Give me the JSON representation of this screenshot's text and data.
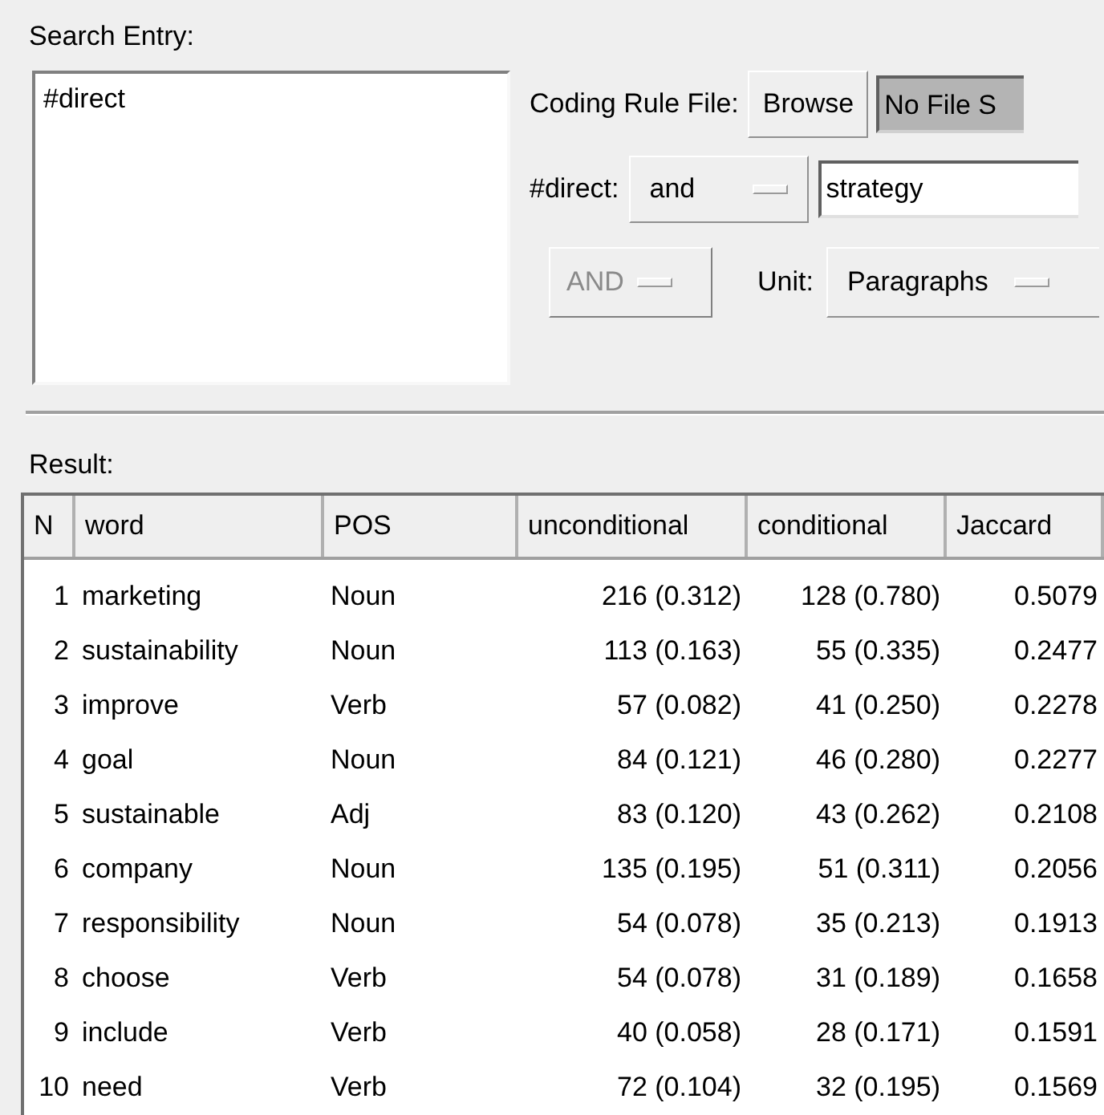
{
  "search_entry": {
    "label": "Search Entry:",
    "value": "#direct"
  },
  "coding_rule": {
    "label": "Coding Rule File:",
    "browse_button": "Browse",
    "file_field": "No File S"
  },
  "condition": {
    "label": "#direct:",
    "operator": "and",
    "value": "strategy"
  },
  "combine": {
    "operator": "AND",
    "disabled": true,
    "unit_label": "Unit:",
    "unit": "Paragraphs"
  },
  "result": {
    "label": "Result:",
    "columns": [
      "N",
      "word",
      "POS",
      "unconditional",
      "conditional",
      "Jaccard"
    ],
    "rows": [
      [
        "1",
        "marketing",
        "Noun",
        "216 (0.312)",
        "128 (0.780)",
        "0.5079"
      ],
      [
        "2",
        "sustainability",
        "Noun",
        "113 (0.163)",
        "55 (0.335)",
        "0.2477"
      ],
      [
        "3",
        "improve",
        "Verb",
        "57 (0.082)",
        "41 (0.250)",
        "0.2278"
      ],
      [
        "4",
        "goal",
        "Noun",
        "84 (0.121)",
        "46 (0.280)",
        "0.2277"
      ],
      [
        "5",
        "sustainable",
        "Adj",
        "83 (0.120)",
        "43 (0.262)",
        "0.2108"
      ],
      [
        "6",
        "company",
        "Noun",
        "135 (0.195)",
        "51 (0.311)",
        "0.2056"
      ],
      [
        "7",
        "responsibility",
        "Noun",
        "54 (0.078)",
        "35 (0.213)",
        "0.1913"
      ],
      [
        "8",
        "choose",
        "Verb",
        "54 (0.078)",
        "31 (0.189)",
        "0.1658"
      ],
      [
        "9",
        "include",
        "Verb",
        "40 (0.058)",
        "28 (0.171)",
        "0.1591"
      ],
      [
        "10",
        "need",
        "Verb",
        "72 (0.104)",
        "32 (0.195)",
        "0.1569"
      ]
    ]
  }
}
